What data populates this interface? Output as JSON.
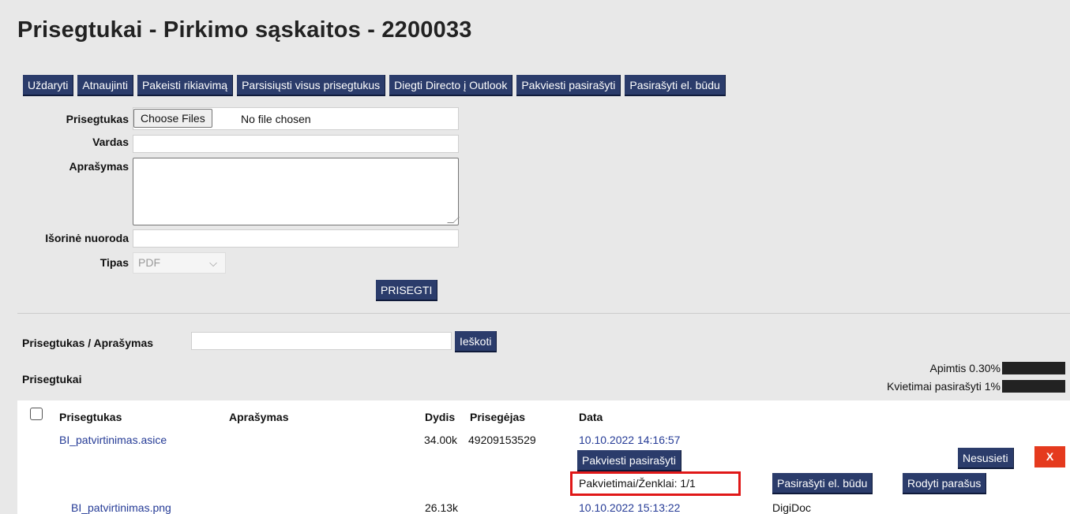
{
  "title": "Prisegtukai - Pirkimo sąskaitos - 2200033",
  "toolbar": [
    "Uždaryti",
    "Atnaujinti",
    "Pakeisti rikiavimą",
    "Parsisiųsti visus prisegtukus",
    "Diegti Directo į Outlook",
    "Pakviesti pasirašyti",
    "Pasirašyti el. būdu"
  ],
  "form": {
    "attachment_label": "Prisegtukas",
    "choose_files": "Choose Files",
    "no_file": "No file chosen",
    "name_label": "Vardas",
    "description_label": "Aprašymas",
    "external_link_label": "Išorinė nuoroda",
    "type_label": "Tipas",
    "type_value": "PDF",
    "attach_button": "PRISEGTI"
  },
  "search": {
    "label": "Prisegtukas / Aprašymas",
    "button": "Ieškoti"
  },
  "attachments": {
    "section_label": "Prisegtukai",
    "volume_label": "Apimtis 0.30%",
    "invites_label": "Kvietimai pasirašyti 1%",
    "columns": [
      "Prisegtukas",
      "Aprašymas",
      "Dydis",
      "Prisegėjas",
      "Data"
    ],
    "rows": [
      {
        "name": "BI_patvirtinimas.asice",
        "size": "34.00k",
        "uploader": "49209153529",
        "date": "10.10.2022 14:16:57",
        "invite_button": "Pakviesti pasirašyti",
        "invites_status": "Pakvietimai/Ženklai: 1/1",
        "sign_button": "Pasirašyti el. būdu",
        "show_signatures_button": "Rodyti parašus",
        "unlink_button": "Nesusieti",
        "delete_button": "X"
      },
      {
        "name": "BI_patvirtinimas.png",
        "size": "26.13k",
        "date": "10.10.2022 15:13:22",
        "extra": "DigiDoc"
      }
    ]
  }
}
